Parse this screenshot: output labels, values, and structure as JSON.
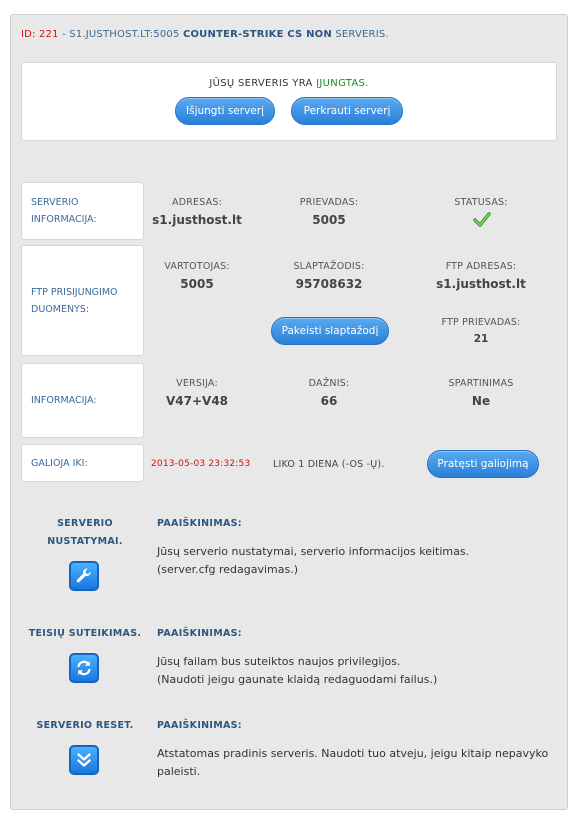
{
  "header": {
    "id": "ID: 221",
    "separator": " - ",
    "host": "S1.JUSTHOST.LT:5005",
    "game": "COUNTER-STRIKE CS NON",
    "suffix": "SERVERIS."
  },
  "status": {
    "prefix": "JŪSŲ SERVERIS YRA",
    "state": "ĮJUNGTAS.",
    "stop_button": "Išjungti serverį",
    "restart_button": "Perkrauti serverį"
  },
  "server_info": {
    "label_line1": "SERVERIO",
    "label_line2": "INFORMACIJA:",
    "address_caption": "ADRESAS:",
    "address": "s1.justhost.lt",
    "port_caption": "PRIEVADAS:",
    "port": "5005",
    "status_caption": "STATUSAS:"
  },
  "ftp": {
    "label_line1": "FTP PRISIJUNGIMO",
    "label_line2": "DUOMENYS:",
    "user_caption": "VARTOTOJAS:",
    "user": "5005",
    "password_caption": "SLAPTAŽODIS:",
    "password": "95708632",
    "address_caption": "FTP ADRESAS:",
    "address": "s1.justhost.lt",
    "change_password_button": "Pakeisti slaptažodį",
    "port_caption": "FTP PRIEVADAS:",
    "port": "21"
  },
  "info": {
    "label": "INFORMACIJA:",
    "version_caption": "VERSIJA:",
    "version": "V47+V48",
    "freq_caption": "DAŽNIS:",
    "freq": "66",
    "boost_caption": "SPARTINIMAS",
    "boost": "Ne"
  },
  "validity": {
    "label": "GALIOJA IKI:",
    "date": "2013-05-03 23:32:53",
    "remaining": "LIKO 1 DIENA (-OS -Ų).",
    "extend_button": "Pratęsti galiojimą"
  },
  "tools": [
    {
      "title_line1": "SERVERIO",
      "title_line2": "NUSTATYMAI.",
      "expl_header": "PAAIŠKINIMAS:",
      "line1": "Jūsų serverio nustatymai, serverio informacijos keitimas.",
      "line2": "(server.cfg redagavimas.)",
      "icon": "wrench-icon"
    },
    {
      "title_line1": "TEISIŲ SUTEIKIMAS.",
      "expl_header": "PAAIŠKINIMAS:",
      "line1": "Jūsų failam bus suteiktos naujos privilegijos.",
      "line2": "(Naudoti jeigu gaunate klaidą redaguodami failus.)",
      "icon": "refresh-icon"
    },
    {
      "title_line1": "SERVERIO RESET.",
      "expl_header": "PAAIŠKINIMAS:",
      "line1": "Atstatomas pradinis serveris. Naudoti tuo atveju, jeigu kitaip nepavyko",
      "line2": "paleisti.",
      "icon": "double-chevron-down-icon"
    }
  ],
  "colors": {
    "accent": "#2a7fd8",
    "link": "#3a6a9a",
    "on": "#1b8a1b",
    "date": "#cc1111"
  }
}
